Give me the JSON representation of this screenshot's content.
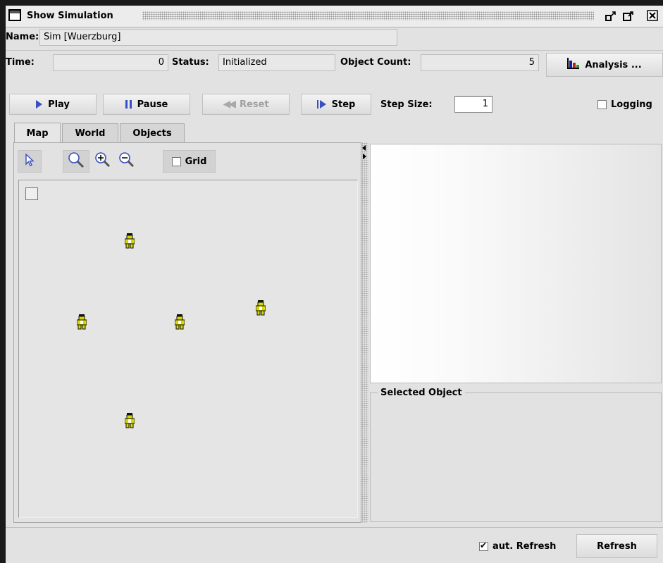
{
  "window": {
    "title": "Show Simulation"
  },
  "fields": {
    "name_label": "Name:",
    "name_value": "Sim [Wuerzburg]",
    "time_label": "Time:",
    "time_value": "0",
    "status_label": "Status:",
    "status_value": "Initialized",
    "count_label": "Object Count:",
    "count_value": "5"
  },
  "buttons": {
    "analysis": "Analysis ...",
    "play": "Play",
    "pause": "Pause",
    "reset": "Reset",
    "step": "Step",
    "refresh": "Refresh"
  },
  "step_size": {
    "label": "Step Size:",
    "value": "1"
  },
  "logging": {
    "label": "Logging",
    "checked": false
  },
  "tabs": [
    {
      "label": "Map",
      "active": true
    },
    {
      "label": "World",
      "active": false
    },
    {
      "label": "Objects",
      "active": false
    }
  ],
  "map_toolbar": {
    "grid_label": "Grid",
    "grid_checked": false
  },
  "selected_object": {
    "title": "Selected Object"
  },
  "footer": {
    "auto_refresh_label": "aut. Refresh",
    "auto_refresh_checked": true
  },
  "colors": {
    "accent_blue": "#3b4fbe",
    "agent_yellow": "#d6d600"
  },
  "icons": [
    "window-icon",
    "restore-icon",
    "maximize-icon",
    "close-icon",
    "play-icon",
    "pause-icon",
    "rewind-icon",
    "step-icon",
    "chart-icon",
    "arrow-cursor-icon",
    "zoom-icon",
    "zoom-in-icon",
    "zoom-out-icon",
    "person-icon"
  ]
}
